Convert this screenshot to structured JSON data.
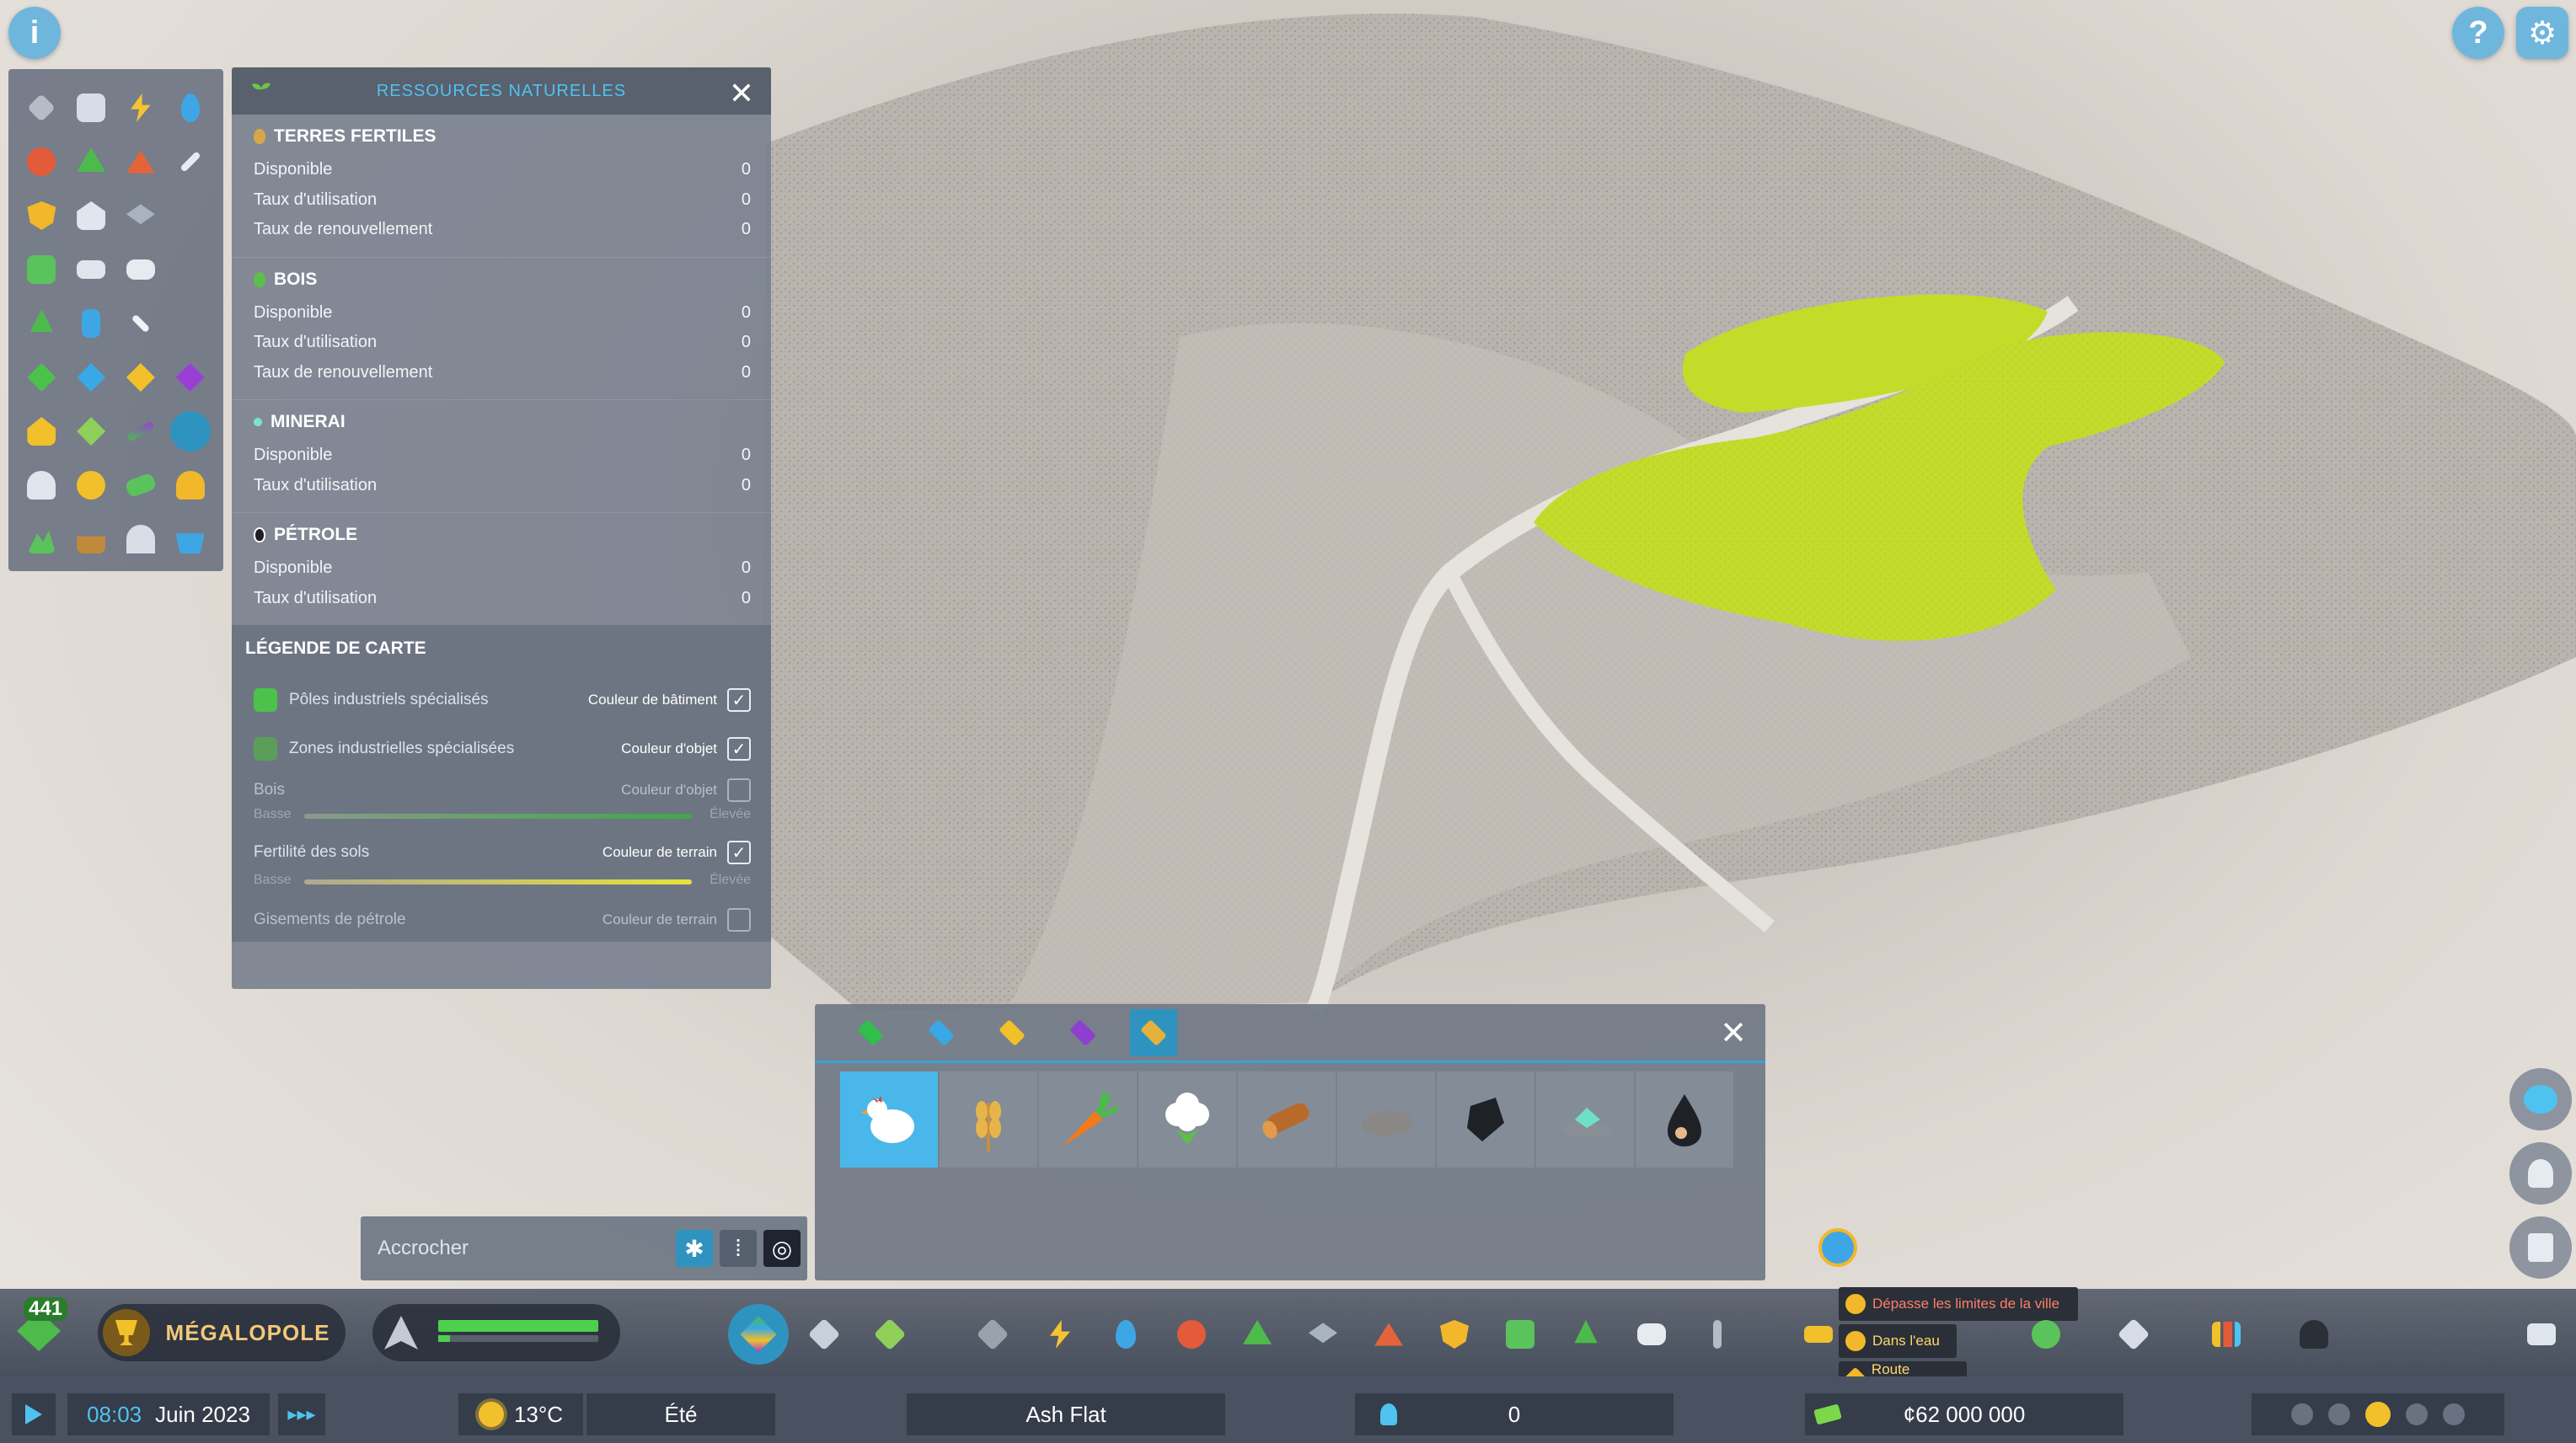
{
  "colors": {
    "accent": "#2f93c0",
    "title_blue": "#4fc3ef",
    "fertile_yellow": "#c8e024",
    "money_green": "#7ad84a",
    "warning_red": "#ff7e6a"
  },
  "top_icons": {
    "info": "info-icon",
    "help": "help-icon",
    "settings": "gear-icon"
  },
  "panel": {
    "title": "RESSOURCES NATURELLES",
    "sections": [
      {
        "title": "TERRES FERTILES",
        "icon": "wheat-icon",
        "rows": [
          {
            "label": "Disponible",
            "value": "0"
          },
          {
            "label": "Taux d'utilisation",
            "value": "0"
          },
          {
            "label": "Taux de renouvellement",
            "value": "0"
          }
        ]
      },
      {
        "title": "BOIS",
        "icon": "tree-icon",
        "rows": [
          {
            "label": "Disponible",
            "value": "0"
          },
          {
            "label": "Taux d'utilisation",
            "value": "0"
          },
          {
            "label": "Taux de renouvellement",
            "value": "0"
          }
        ]
      },
      {
        "title": "MINERAI",
        "icon": "ore-icon",
        "rows": [
          {
            "label": "Disponible",
            "value": "0"
          },
          {
            "label": "Taux d'utilisation",
            "value": "0"
          }
        ]
      },
      {
        "title": "PÉTROLE",
        "icon": "oil-drop-icon",
        "rows": [
          {
            "label": "Disponible",
            "value": "0"
          },
          {
            "label": "Taux d'utilisation",
            "value": "0"
          }
        ]
      }
    ],
    "legend": {
      "title": "LÉGENDE DE CARTE",
      "items": [
        {
          "name": "Pôles industriels spécialisés",
          "color_label": "Couleur de bâtiment",
          "checked": true
        },
        {
          "name": "Zones industrielles spécialisées",
          "color_label": "Couleur d'objet",
          "checked": true
        },
        {
          "name": "Bois",
          "color_label": "Couleur d'objet",
          "checked": false,
          "low": "Basse",
          "high": "Élevée"
        },
        {
          "name": "Fertilité des sols",
          "color_label": "Couleur de terrain",
          "checked": true,
          "low": "Basse",
          "high": "Élevée"
        },
        {
          "name": "Gisements de pétrole",
          "color_label": "Couleur de terrain",
          "checked": false
        }
      ]
    }
  },
  "snap": {
    "label": "Accrocher"
  },
  "picker": {
    "tabs": [
      "specialized-green-icon",
      "specialized-blue-icon",
      "specialized-yellow-icon",
      "specialized-purple-icon",
      "specialized-farm-icon"
    ],
    "items": [
      "chicken-icon",
      "wheat-icon",
      "carrot-icon",
      "cotton-icon",
      "log-icon",
      "stone-icon",
      "coal-icon",
      "ore-crystal-icon",
      "oil-drop-icon"
    ]
  },
  "hud": {
    "xp": "441",
    "milestone": "MÉGALOPOLE",
    "warnings": [
      "Dépasse les limites de la ville",
      "Dans l'eau",
      "Route requise"
    ],
    "time": "08:03",
    "date": "Juin 2023",
    "temperature": "13°C",
    "season": "Été",
    "city_name": "Ash Flat",
    "population": "0",
    "money": "¢62 000 000"
  }
}
